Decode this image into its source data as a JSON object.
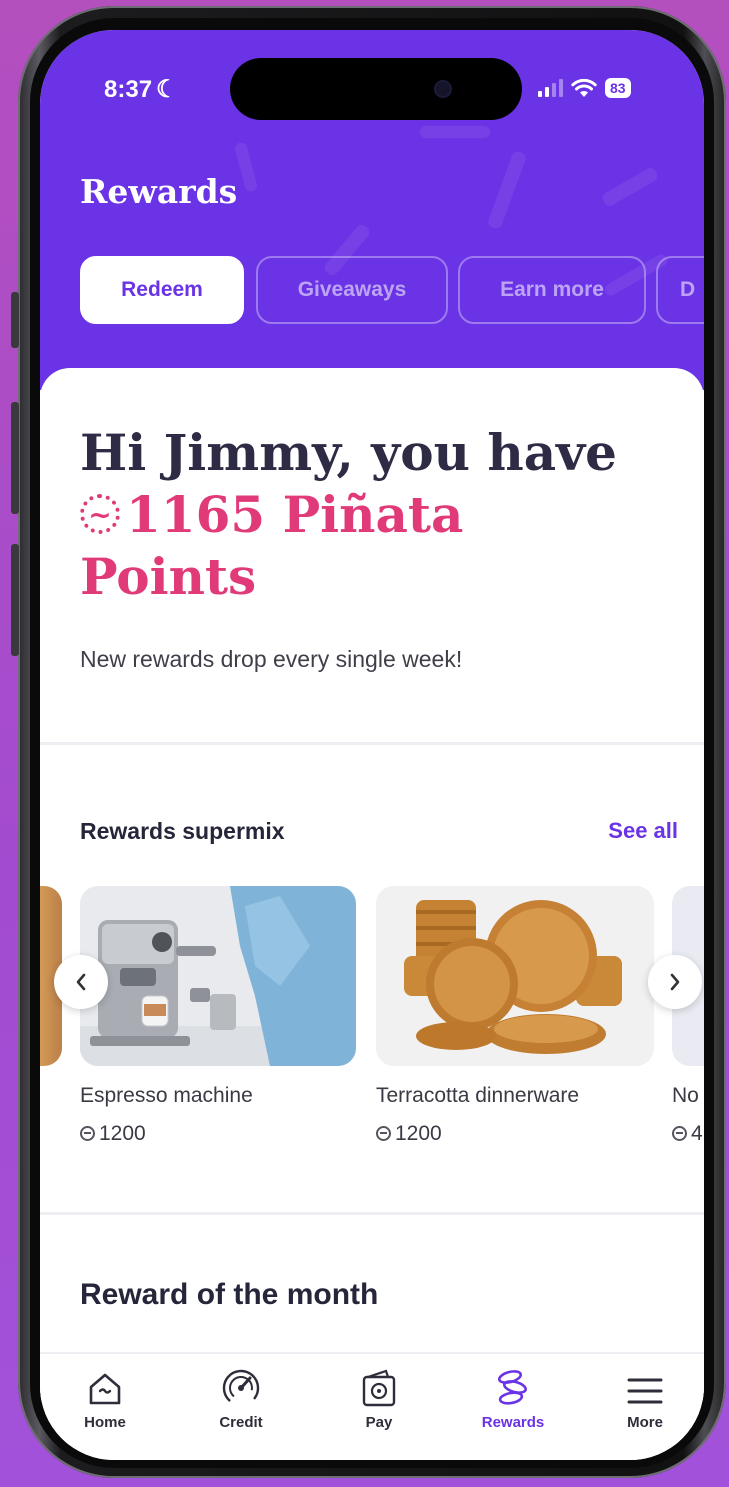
{
  "status_bar": {
    "time": "8:37",
    "battery": "83"
  },
  "page": {
    "title": "Rewards"
  },
  "tabs": [
    {
      "label": "Redeem",
      "active": true
    },
    {
      "label": "Giveaways",
      "active": false
    },
    {
      "label": "Earn more",
      "active": false
    },
    {
      "label": "D",
      "active": false
    }
  ],
  "greeting": {
    "line1": "Hi Jimmy, you have",
    "points": "1165 Piñata",
    "points_word": "Points",
    "subtitle": "New rewards drop every single week!"
  },
  "supermix": {
    "title": "Rewards supermix",
    "see_all": "See all",
    "products": [
      {
        "name": "Espresso machine",
        "price": "1200"
      },
      {
        "name": "Terracotta dinnerware",
        "price": "1200"
      },
      {
        "name": "No",
        "price": "4"
      }
    ]
  },
  "reward_of_month": {
    "title": "Reward of the month"
  },
  "nav": [
    {
      "label": "Home",
      "icon": "home-icon"
    },
    {
      "label": "Credit",
      "icon": "gauge-icon"
    },
    {
      "label": "Pay",
      "icon": "wallet-icon"
    },
    {
      "label": "Rewards",
      "icon": "coins-icon",
      "active": true
    },
    {
      "label": "More",
      "icon": "hamburger-menu-icon"
    }
  ],
  "colors": {
    "brand_purple": "#6b33e6",
    "points_pink": "#e03a78",
    "background": "#a24bd0"
  }
}
